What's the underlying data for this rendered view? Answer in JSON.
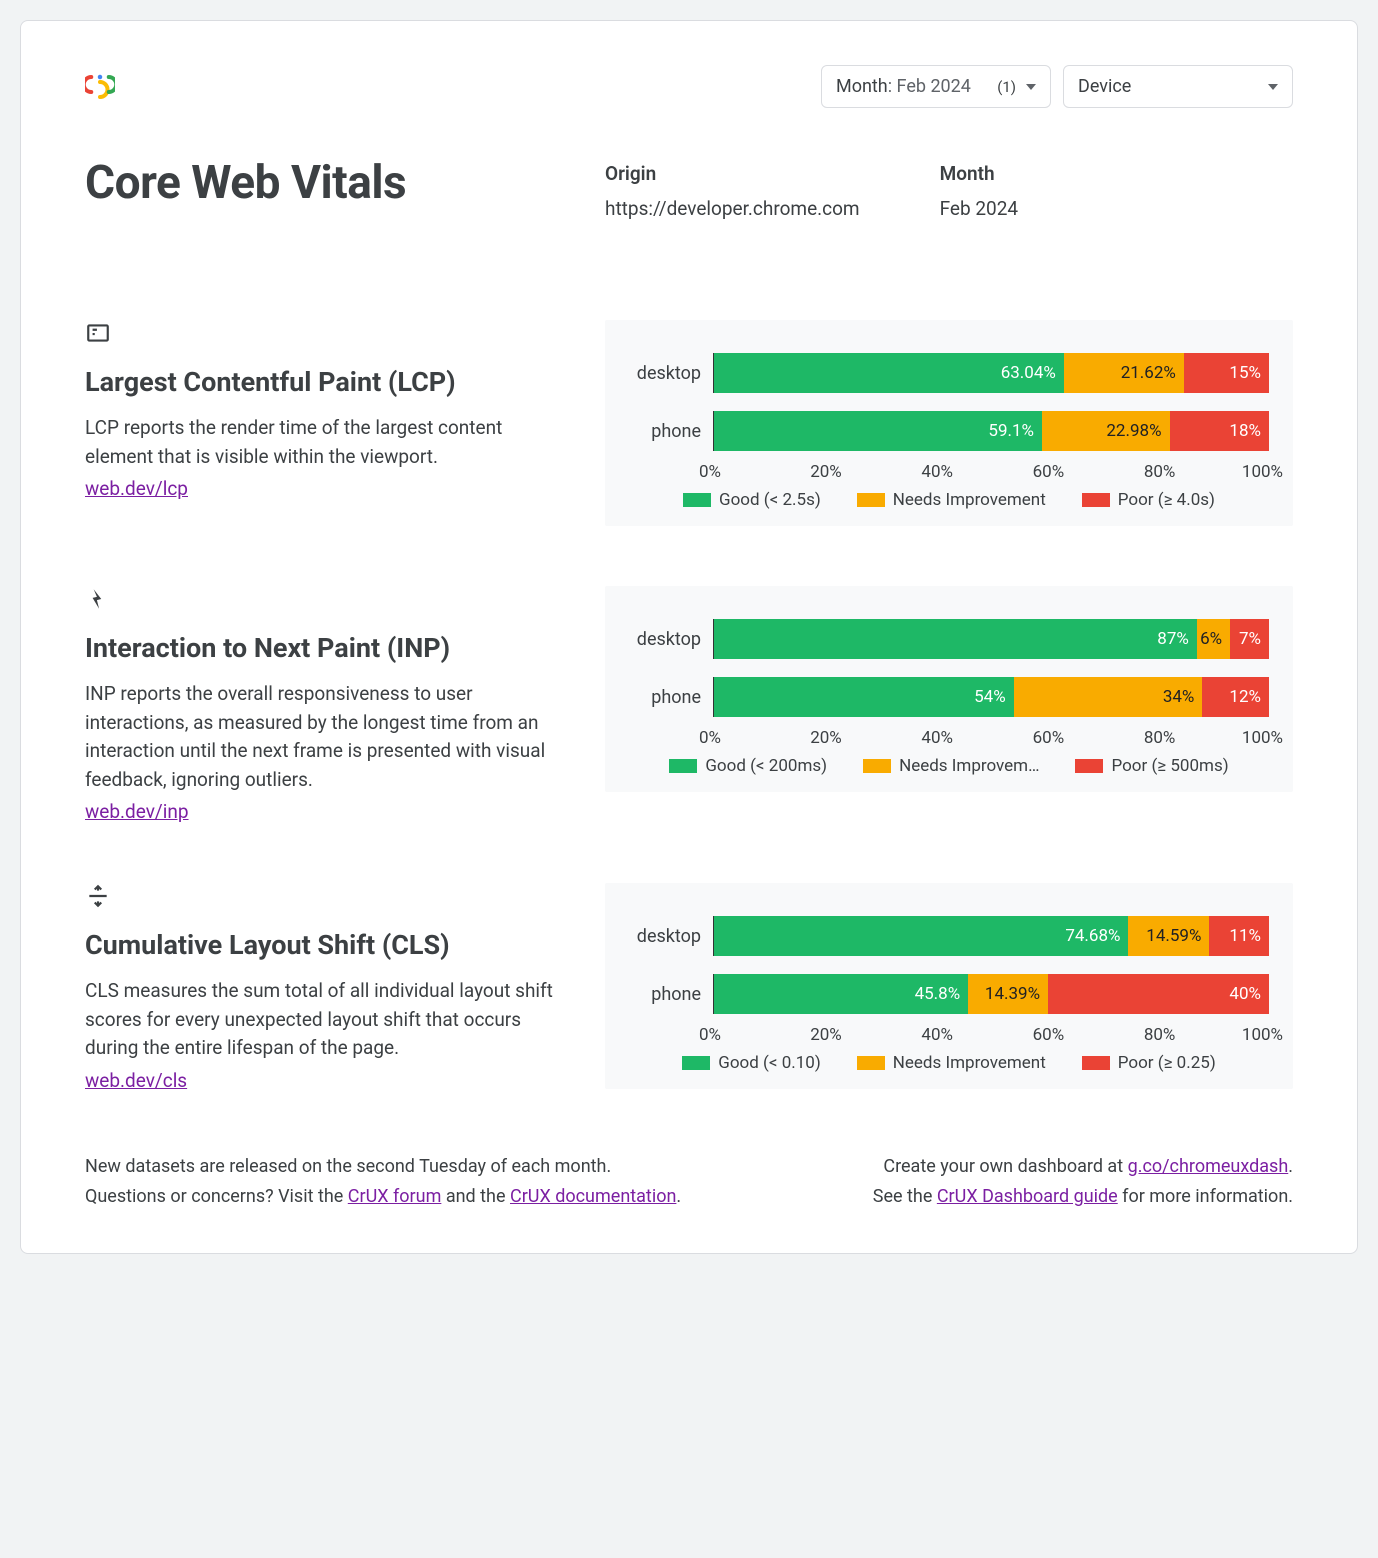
{
  "filters": {
    "month_label": "Month",
    "month_value": ": Feb 2024",
    "month_count": "(1)",
    "device_label": "Device"
  },
  "title": "Core Web Vitals",
  "meta": {
    "origin_label": "Origin",
    "origin_value": "https://developer.chrome.com",
    "month_label": "Month",
    "month_value": "Feb 2024"
  },
  "axis_ticks": [
    "0%",
    "20%",
    "40%",
    "60%",
    "80%",
    "100%"
  ],
  "metrics": [
    {
      "key": "lcp",
      "title": "Largest Contentful Paint (LCP)",
      "desc": "LCP reports the render time of the largest content element that is visible within the viewport.",
      "link": "web.dev/lcp",
      "legend": {
        "good": "Good (< 2.5s)",
        "ni": "Needs Improvement",
        "poor": "Poor (≥ 4.0s)"
      },
      "rows": [
        {
          "label": "desktop",
          "good": 63.04,
          "good_t": "63.04%",
          "ni": 21.62,
          "ni_t": "21.62%",
          "poor": 15.34,
          "poor_t": "15%"
        },
        {
          "label": "phone",
          "good": 59.1,
          "good_t": "59.1%",
          "ni": 22.98,
          "ni_t": "22.98%",
          "poor": 17.92,
          "poor_t": "18%"
        }
      ]
    },
    {
      "key": "inp",
      "title": "Interaction to Next Paint (INP)",
      "desc": "INP reports the overall responsiveness to user interactions, as measured by the longest time from an interaction until the next frame is presented with visual feedback, ignoring outliers.",
      "link": "web.dev/inp",
      "legend": {
        "good": "Good (< 200ms)",
        "ni": "Needs Improvem…",
        "poor": "Poor (≥ 500ms)"
      },
      "rows": [
        {
          "label": "desktop",
          "good": 87,
          "good_t": "87%",
          "ni": 6,
          "ni_t": "6%",
          "poor": 7,
          "poor_t": "7%"
        },
        {
          "label": "phone",
          "good": 54,
          "good_t": "54%",
          "ni": 34,
          "ni_t": "34%",
          "poor": 12,
          "poor_t": "12%"
        }
      ]
    },
    {
      "key": "cls",
      "title": "Cumulative Layout Shift (CLS)",
      "desc": "CLS measures the sum total of all individual layout shift scores for every unexpected layout shift that occurs during the entire lifespan of the page.",
      "link": "web.dev/cls",
      "legend": {
        "good": "Good (< 0.10)",
        "ni": "Needs Improvement",
        "poor": "Poor (≥ 0.25)"
      },
      "rows": [
        {
          "label": "desktop",
          "good": 74.68,
          "good_t": "74.68%",
          "ni": 14.59,
          "ni_t": "14.59%",
          "poor": 10.73,
          "poor_t": "11%"
        },
        {
          "label": "phone",
          "good": 45.8,
          "good_t": "45.8%",
          "ni": 14.39,
          "ni_t": "14.39%",
          "poor": 39.81,
          "poor_t": "40%"
        }
      ]
    }
  ],
  "footer": {
    "l1": "New datasets are released on the second Tuesday of each month.",
    "l2a": "Questions or concerns? Visit the ",
    "l2link1": "CrUX forum",
    "l2b": " and the ",
    "l2link2": "CrUX documentation",
    "l2c": ".",
    "r1a": "Create your own dashboard at ",
    "r1link": "g.co/chromeuxdash",
    "r1b": ".",
    "r2a": "See the ",
    "r2link": "CrUX Dashboard guide",
    "r2b": " for more information."
  },
  "chart_data": [
    {
      "type": "bar",
      "title": "Largest Contentful Paint (LCP)",
      "categories": [
        "desktop",
        "phone"
      ],
      "series": [
        {
          "name": "Good (< 2.5s)",
          "values": [
            63.04,
            59.1
          ]
        },
        {
          "name": "Needs Improvement",
          "values": [
            21.62,
            22.98
          ]
        },
        {
          "name": "Poor (≥ 4.0s)",
          "values": [
            15.34,
            17.92
          ]
        }
      ],
      "xlabel": "",
      "ylabel": "%",
      "ylim": [
        0,
        100
      ]
    },
    {
      "type": "bar",
      "title": "Interaction to Next Paint (INP)",
      "categories": [
        "desktop",
        "phone"
      ],
      "series": [
        {
          "name": "Good (< 200ms)",
          "values": [
            87,
            54
          ]
        },
        {
          "name": "Needs Improvement",
          "values": [
            6,
            34
          ]
        },
        {
          "name": "Poor (≥ 500ms)",
          "values": [
            7,
            12
          ]
        }
      ],
      "xlabel": "",
      "ylabel": "%",
      "ylim": [
        0,
        100
      ]
    },
    {
      "type": "bar",
      "title": "Cumulative Layout Shift (CLS)",
      "categories": [
        "desktop",
        "phone"
      ],
      "series": [
        {
          "name": "Good (< 0.10)",
          "values": [
            74.68,
            45.8
          ]
        },
        {
          "name": "Needs Improvement",
          "values": [
            14.59,
            14.39
          ]
        },
        {
          "name": "Poor (≥ 0.25)",
          "values": [
            10.73,
            39.81
          ]
        }
      ],
      "xlabel": "",
      "ylabel": "%",
      "ylim": [
        0,
        100
      ]
    }
  ]
}
